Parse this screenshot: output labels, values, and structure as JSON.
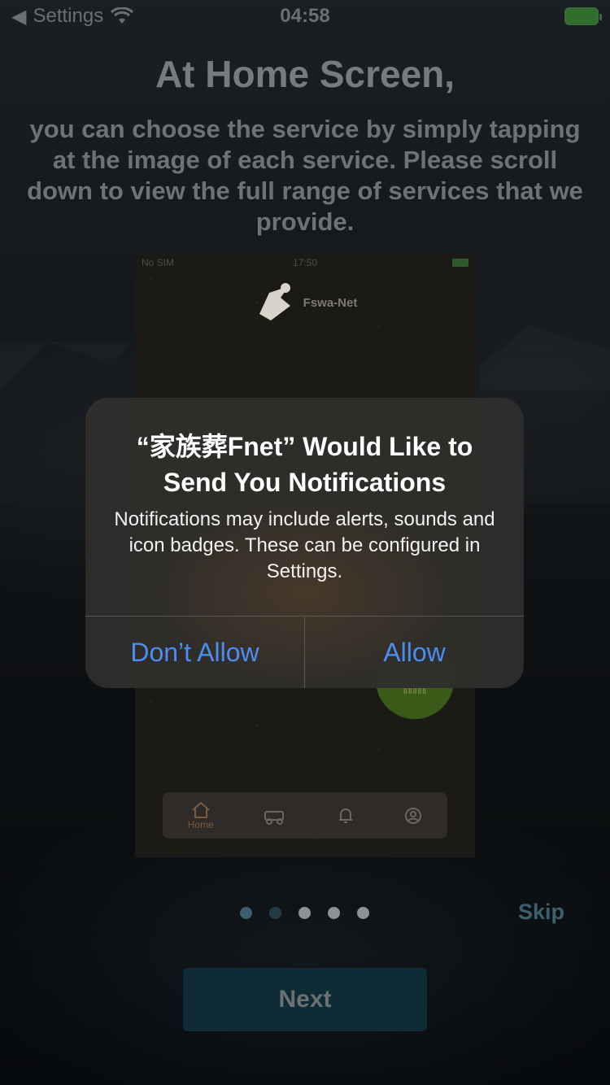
{
  "status_bar": {
    "back_label": "Settings",
    "time": "04:58",
    "back_icon": "chevron-left-icon",
    "wifi_icon": "wifi-icon",
    "battery_icon": "battery-charging-icon"
  },
  "onboarding": {
    "title": "At Home Screen,",
    "subtitle": "you can choose the service by simply tapping at the image of each service. Please scroll down to view the full range of services that we provide.",
    "page_count": 5,
    "current_page": 1,
    "skip_label": "Skip",
    "next_label": "Next"
  },
  "preview": {
    "carrier": "No SIM",
    "time": "17:50",
    "brand_name": "Fswa-Net",
    "tabs": [
      {
        "label": "Home",
        "icon": "home-icon"
      },
      {
        "label": "",
        "icon": "hearse-icon"
      },
      {
        "label": "",
        "icon": "bell-icon"
      },
      {
        "label": "",
        "icon": "user-icon"
      }
    ]
  },
  "alert": {
    "title": "“家族葬Fnet” Would Like to Send You Notifications",
    "message": "Notifications may include alerts, sounds and icon badges. These can be configured in Settings.",
    "deny_label": "Don’t Allow",
    "allow_label": "Allow",
    "button_color": "#4d8cf0"
  }
}
